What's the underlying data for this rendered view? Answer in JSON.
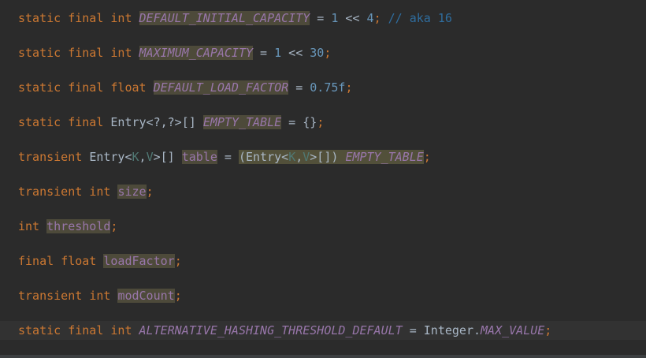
{
  "theme": {
    "background": "#2b2b2b",
    "keyword_color": "#cc7832",
    "static_field_color": "#9876aa",
    "number_color": "#6897bb",
    "comment_color": "#2f6d9e",
    "default_text_color": "#a9b7c6",
    "highlight_color": "#4d4a3a"
  },
  "lines": [
    {
      "kw1": "static",
      "kw2": "final",
      "kw3": "int",
      "name": "DEFAULT_INITIAL_CAPACITY",
      "eq": " = ",
      "num1": "1",
      "op": " << ",
      "num2": "4",
      "semi": ";",
      "comment": "// aka 16"
    },
    {
      "kw1": "static",
      "kw2": "final",
      "kw3": "int",
      "name": "MAXIMUM_CAPACITY",
      "eq": " = ",
      "num1": "1",
      "op": " << ",
      "num2": "30",
      "semi": ";"
    },
    {
      "kw1": "static",
      "kw2": "final",
      "kw3": "float",
      "name": "DEFAULT_LOAD_FACTOR",
      "eq": " = ",
      "num1": "0.75f",
      "semi": ";"
    },
    {
      "kw1": "static",
      "kw2": "final",
      "type": "Entry<?,?>[]",
      "name": "EMPTY_TABLE",
      "rest": " = {}",
      "semi": ";"
    },
    {
      "kw1": "transient",
      "type_pre": "Entry<",
      "tp1": "K",
      "comma": ",",
      "tp2": "V",
      "type_post": ">[]",
      "name": "table",
      "eq": " = ",
      "cast_pre": "(Entry<",
      "ctp1": "K",
      "ccomma": ",",
      "ctp2": "V",
      "cast_post": ">[])",
      "ref": "EMPTY_TABLE",
      "semi": ";"
    },
    {
      "kw1": "transient",
      "kw2": "int",
      "name": "size",
      "semi": ";"
    },
    {
      "kw1": "int",
      "name": "threshold",
      "semi": ";"
    },
    {
      "kw1": "final",
      "kw2": "float",
      "name": "loadFactor",
      "semi": ";"
    },
    {
      "kw1": "transient",
      "kw2": "int",
      "name": "modCount",
      "semi": ";"
    },
    {
      "kw1": "static",
      "kw2": "final",
      "kw3": "int",
      "name": "ALTERNATIVE_HASHING_THRESHOLD_DEFAULT",
      "eq": " = ",
      "cls": "Integer.",
      "ref": "MAX_VALUE",
      "semi": ";"
    }
  ]
}
